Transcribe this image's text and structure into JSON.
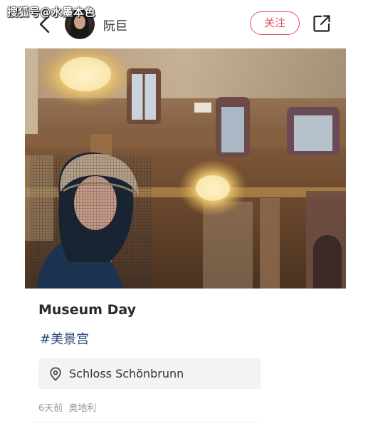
{
  "watermark": "搜狐号@水墨本色",
  "header": {
    "username": "阮巨",
    "follow_label": "关注"
  },
  "icons": {
    "back": "chevron-left-icon",
    "share": "share-out-icon",
    "location": "map-pin-icon"
  },
  "colors": {
    "accent": "#e0505a",
    "hashtag": "#2c4a7c",
    "meta": "#999999",
    "chip_bg": "#f3f3f4"
  },
  "post": {
    "title": "Museum Day",
    "hashtag": "#美景宫",
    "location": "Schloss Schönbrunn",
    "time": "6天前",
    "region": "奥地利"
  }
}
